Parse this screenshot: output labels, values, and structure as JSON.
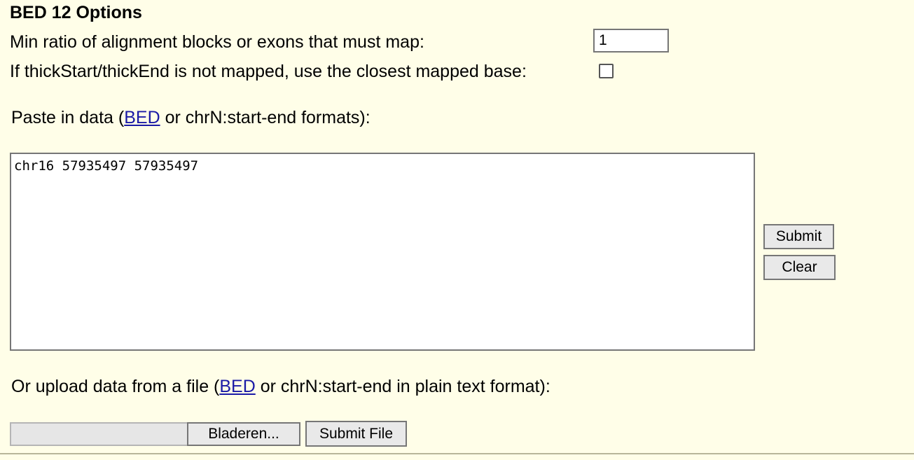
{
  "bed12": {
    "heading": "BED 12 Options",
    "min_ratio_label": "Min ratio of alignment blocks or exons that must map:",
    "min_ratio_value": "1",
    "thick_label": "If thickStart/thickEnd is not mapped, use the closest mapped base:",
    "thick_checked": false
  },
  "paste": {
    "label_prefix": "Paste in data (",
    "link": "BED",
    "label_suffix": " or chrN:start-end formats):",
    "textarea_value": "chr16 57935497 57935497",
    "submit_label": "Submit",
    "clear_label": "Clear"
  },
  "upload": {
    "label_prefix": "Or upload data from a file (",
    "link": "BED",
    "label_suffix": " or chrN:start-end in plain text format):",
    "browse_label": "Bladeren...",
    "submit_file_label": "Submit File"
  },
  "colors": {
    "background": "#fffee8",
    "link": "#1a1aa6",
    "button_bg": "#e9e9e9"
  }
}
